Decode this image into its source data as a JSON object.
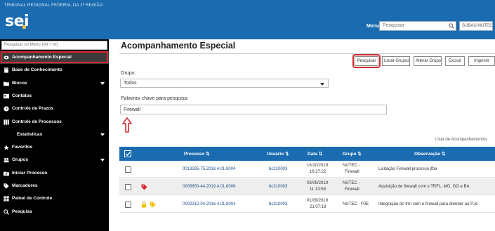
{
  "header": {
    "org_name": "TRIBUNAL REGIONAL FEDERAL DA 1ª REGIÃO",
    "logo_text": "sei",
    "unit_label": "Menu",
    "search_placeholder": "Pesquisar",
    "unit_select_value": "SUBAU-NUTEC"
  },
  "sidebar": {
    "search_placeholder": "Pesquisar no Menu (Alt + m)",
    "items": [
      {
        "label": "Acompanhamento Especial",
        "icon": "eye-icon",
        "active": true,
        "arrow": false,
        "sub": false
      },
      {
        "label": "Base de Conhecimento",
        "icon": "book-icon",
        "active": false,
        "arrow": false,
        "sub": false
      },
      {
        "label": "Blocos",
        "icon": "folder-icon",
        "active": false,
        "arrow": true,
        "sub": false
      },
      {
        "label": "Contatos",
        "icon": "contact-card-icon",
        "active": false,
        "arrow": false,
        "sub": false
      },
      {
        "label": "Controle de Prazos",
        "icon": "clock-icon",
        "active": false,
        "arrow": false,
        "sub": false
      },
      {
        "label": "Controle de Processos",
        "icon": "columns-icon",
        "active": false,
        "arrow": false,
        "sub": false
      },
      {
        "label": "Estatísticas",
        "icon": "none",
        "active": false,
        "arrow": true,
        "sub": true
      },
      {
        "label": "Favoritos",
        "icon": "star-icon",
        "active": false,
        "arrow": false,
        "sub": false
      },
      {
        "label": "Grupos",
        "icon": "users-icon",
        "active": false,
        "arrow": true,
        "sub": false
      },
      {
        "label": "Iniciar Processo",
        "icon": "folder-plus-icon",
        "active": false,
        "arrow": false,
        "sub": false
      },
      {
        "label": "Marcadores",
        "icon": "tag-icon",
        "active": false,
        "arrow": false,
        "sub": false
      },
      {
        "label": "Painel de Controle",
        "icon": "grid-icon",
        "active": false,
        "arrow": false,
        "sub": false
      },
      {
        "label": "Pesquisa",
        "icon": "search-icon",
        "active": false,
        "arrow": false,
        "sub": false
      }
    ]
  },
  "main": {
    "title": "Acompanhamento Especial",
    "toolbar": [
      "Pesquisar",
      "Listar Grupos",
      "Alterar Grupo",
      "Excluir",
      "Imprimir"
    ],
    "group_label": "Grupo:",
    "group_value": "Todos",
    "keywords_label": "Palavras-chave para pesquisa:",
    "keywords_value": "Firewall",
    "list_caption": "Lista de Acompanhamentos",
    "table": {
      "headers": [
        "Processo",
        "Usuário",
        "Data",
        "Grupo",
        "Observação"
      ],
      "rows": [
        {
          "processo": "0013285-75.2018.4.01.8004",
          "usuario": "bc310003",
          "data1": "16/10/2019",
          "data2": "16:27:22",
          "grupo1": "NUTEC -",
          "grupo2": "Firewall",
          "obs": "Licitação Firewall processo jfba",
          "tags": []
        },
        {
          "processo": "0005850-44.2019.4.01.8006",
          "usuario": "bc310003",
          "data1": "03/09/2019",
          "data2": "11:13:58",
          "grupo1": "NUTEC -",
          "grupo2": "Firewall",
          "obs": "Aquisição de firewall com o TRF1, MG, GO e BA",
          "tags": [
            "red-tag"
          ]
        },
        {
          "processo": "0002312-04.2016.4.01.8004",
          "usuario": "bc310003",
          "data1": "01/09/2019",
          "data2": "21:07:18",
          "grupo1": "NUTEC - PJE",
          "grupo2": "",
          "obs": "Integração do trm com o firewall para atender ao PJe",
          "tags": [
            "lock",
            "yellow-tag"
          ]
        }
      ]
    }
  },
  "colors": {
    "header_blue": "#1a6bb0",
    "sidebar_bg": "#000000",
    "highlight_red": "#d9282f"
  }
}
